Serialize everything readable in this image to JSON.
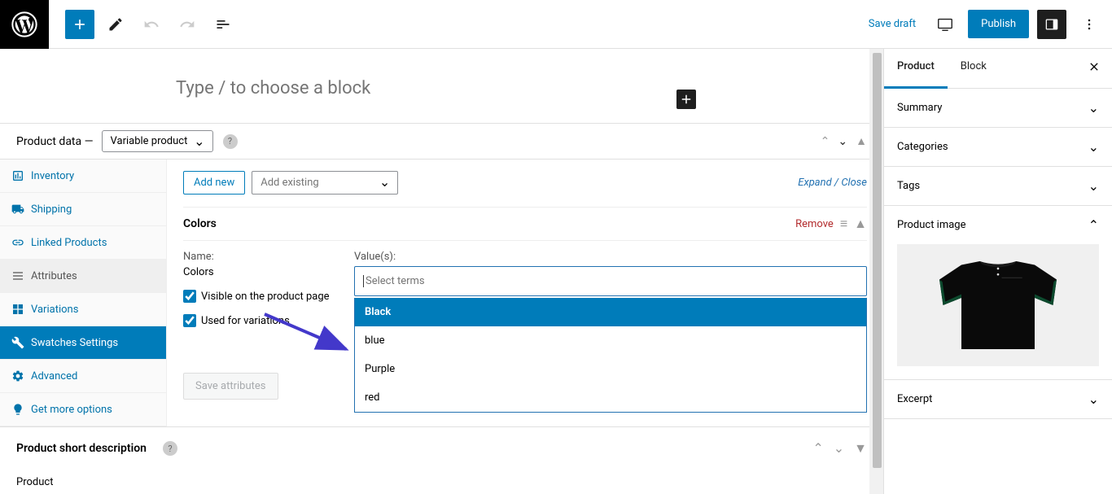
{
  "toolbar": {
    "save_draft": "Save draft",
    "publish": "Publish"
  },
  "editor": {
    "placeholder": "Type / to choose a block"
  },
  "product_data": {
    "label": "Product data —",
    "type_selected": "Variable product",
    "tabs": [
      {
        "label": "Inventory",
        "icon": "inventory"
      },
      {
        "label": "Shipping",
        "icon": "shipping"
      },
      {
        "label": "Linked Products",
        "icon": "link"
      },
      {
        "label": "Attributes",
        "icon": "attributes"
      },
      {
        "label": "Variations",
        "icon": "variations"
      },
      {
        "label": "Swatches Settings",
        "icon": "swatches",
        "active": true
      },
      {
        "label": "Advanced",
        "icon": "advanced"
      },
      {
        "label": "Get more options",
        "icon": "more"
      }
    ],
    "add_new": "Add new",
    "add_existing_placeholder": "Add existing",
    "expand_close": "Expand / Close",
    "attribute": {
      "title": "Colors",
      "remove": "Remove",
      "name_label": "Name:",
      "name_value": "Colors",
      "visible_label": "Visible on the product page",
      "used_label": "Used for variations",
      "values_label": "Value(s):",
      "values_placeholder": "Select terms",
      "options": [
        "Black",
        "blue",
        "Purple",
        "red"
      ]
    },
    "save_attributes": "Save attributes"
  },
  "short_description": {
    "label": "Product short description"
  },
  "footer_label": "Product",
  "sidebar": {
    "tabs": [
      "Product",
      "Block"
    ],
    "panels": [
      {
        "label": "Summary",
        "open": false
      },
      {
        "label": "Categories",
        "open": false
      },
      {
        "label": "Tags",
        "open": false
      },
      {
        "label": "Product image",
        "open": true
      },
      {
        "label": "Excerpt",
        "open": false
      }
    ]
  }
}
